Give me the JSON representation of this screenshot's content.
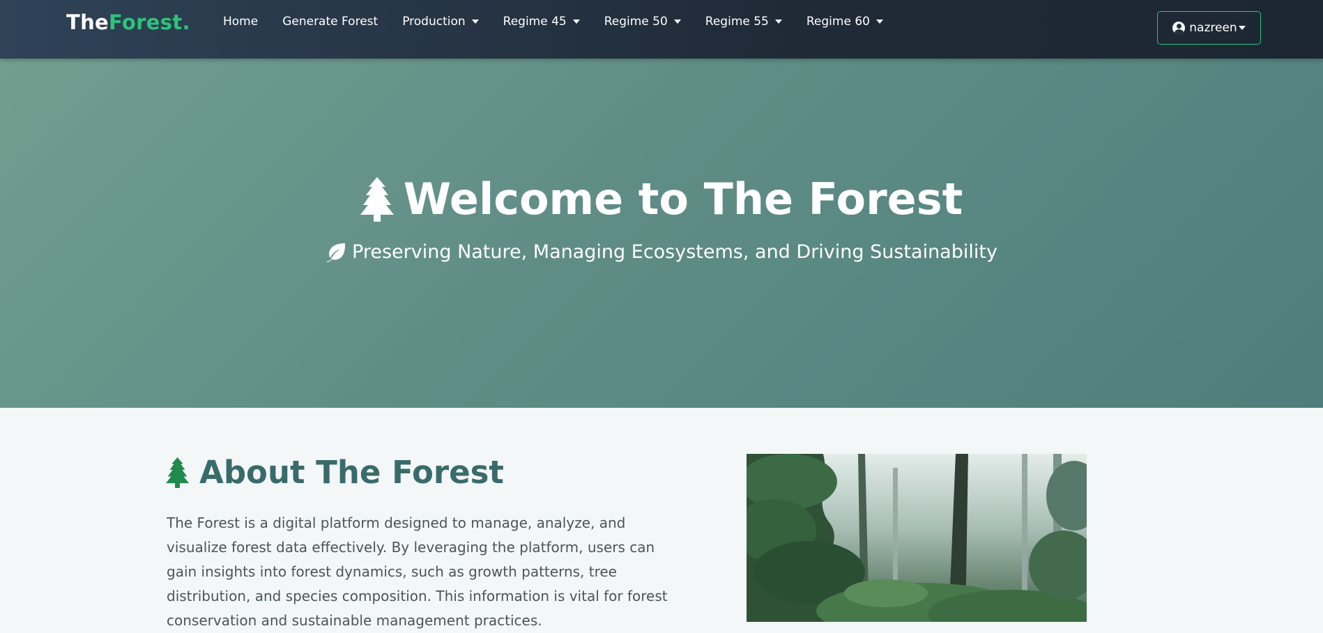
{
  "nav": {
    "brand_part1": "The",
    "brand_part2": "Forest.",
    "links": [
      {
        "label": "Home",
        "dropdown": false
      },
      {
        "label": "Generate Forest",
        "dropdown": false
      },
      {
        "label": "Production",
        "dropdown": true
      },
      {
        "label": "Regime 45",
        "dropdown": true
      },
      {
        "label": "Regime 50",
        "dropdown": true
      },
      {
        "label": "Regime 55",
        "dropdown": true
      },
      {
        "label": "Regime 60",
        "dropdown": true
      }
    ],
    "user": {
      "name": "nazreen",
      "icon": "user-circle-icon"
    }
  },
  "hero": {
    "title": "Welcome to The Forest",
    "title_icon": "tree-icon",
    "subtitle": "Preserving Nature, Managing Ecosystems, and Driving Sustainability",
    "subtitle_icon": "leaf-icon"
  },
  "about": {
    "title": "About The Forest",
    "title_icon": "tree-icon",
    "text": "The Forest is a digital platform designed to manage, analyze, and visualize forest data effectively. By leveraging the platform, users can gain insights into forest dynamics, such as growth patterns, tree distribution, and species composition. This information is vital for forest conservation and sustainable management practices."
  },
  "colors": {
    "accent": "#2fc27a",
    "navbar": "#1f2a37",
    "hero_start": "#729e8f",
    "hero_end": "#4f7d7b",
    "about_title": "#3a6b6b",
    "about_icon": "#1f8a4c"
  }
}
